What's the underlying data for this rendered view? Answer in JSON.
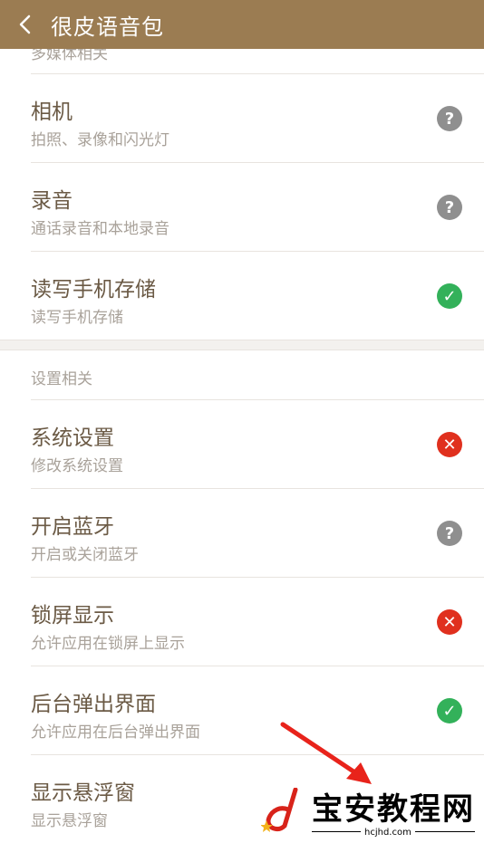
{
  "header": {
    "title": "很皮语音包",
    "back_icon": "chevron-left-icon",
    "bg_color": "#9b7c52"
  },
  "sections": {
    "multimedia_label": "多媒体相关",
    "settings_label": "设置相关"
  },
  "permissions": [
    {
      "name": "相机",
      "desc": "拍照、录像和闪光灯",
      "status": "ask"
    },
    {
      "name": "录音",
      "desc": "通话录音和本地录音",
      "status": "ask"
    },
    {
      "name": "读写手机存储",
      "desc": "读写手机存储",
      "status": "allowed"
    },
    {
      "name": "系统设置",
      "desc": "修改系统设置",
      "status": "denied"
    },
    {
      "name": "开启蓝牙",
      "desc": "开启或关闭蓝牙",
      "status": "ask"
    },
    {
      "name": "锁屏显示",
      "desc": "允许应用在锁屏上显示",
      "status": "denied"
    },
    {
      "name": "后台弹出界面",
      "desc": "允许应用在后台弹出界面",
      "status": "allowed"
    },
    {
      "name": "显示悬浮窗",
      "desc": "显示悬浮窗",
      "status": "none"
    }
  ],
  "status_icons": {
    "ask": "question-icon",
    "allowed": "check-icon",
    "denied": "cross-icon"
  },
  "status_colors": {
    "ask": "#8f8f8f",
    "allowed": "#33b15a",
    "denied": "#e0301e"
  },
  "watermark": {
    "text": "宝安教程网",
    "url": "hcjhd.com"
  }
}
